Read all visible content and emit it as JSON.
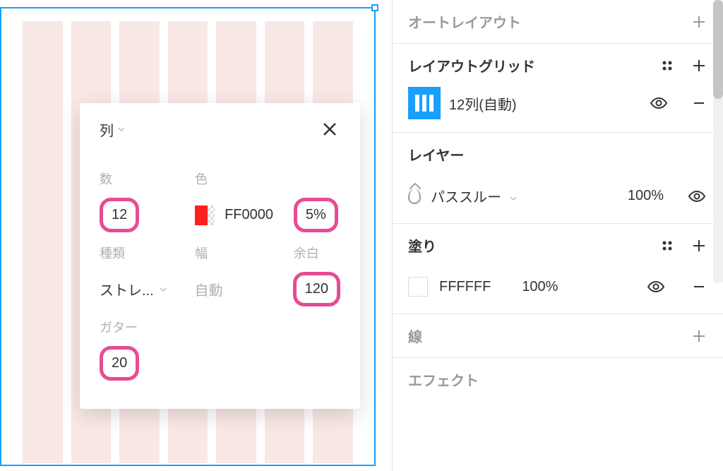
{
  "popup": {
    "title": "列",
    "count_label": "数",
    "count_value": "12",
    "color_label": "色",
    "color_hex": "FF0000",
    "color_opacity": "5%",
    "type_label": "種類",
    "type_value": "ストレ...",
    "width_label": "幅",
    "width_value": "自動",
    "margin_label": "余白",
    "margin_value": "120",
    "gutter_label": "ガター",
    "gutter_value": "20"
  },
  "panel": {
    "autolayout": {
      "title": "オートレイアウト"
    },
    "layoutgrid": {
      "title": "レイアウトグリッド",
      "item_label": "12列(自動)"
    },
    "layer": {
      "title": "レイヤー",
      "blend_mode": "パススルー",
      "opacity": "100%"
    },
    "fill": {
      "title": "塗り",
      "hex": "FFFFFF",
      "opacity": "100%"
    },
    "stroke": {
      "title": "線"
    },
    "effects": {
      "title": "エフェクト"
    }
  }
}
